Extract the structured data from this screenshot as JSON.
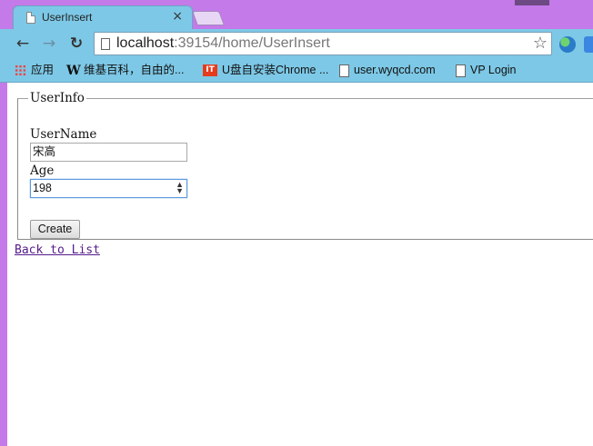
{
  "window": {
    "tab_title": "UserInsert",
    "tab_close": "×"
  },
  "toolbar": {
    "back_icon": "arrow-left-icon",
    "forward_icon": "arrow-right-icon",
    "reload_icon": "reload-icon",
    "url_host": "localhost",
    "url_rest": ":39154/home/UserInsert",
    "star_icon": "star-icon"
  },
  "bookmarks": [
    {
      "icon": "apps-icon",
      "label": "应用"
    },
    {
      "icon": "wikipedia-icon",
      "label": "维基百科，自由的..."
    },
    {
      "icon": "it-icon",
      "label": "U盘自安装Chrome ..."
    },
    {
      "icon": "doc-icon",
      "label": "user.wyqcd.com"
    },
    {
      "icon": "doc-icon",
      "label": "VP Login"
    }
  ],
  "form": {
    "legend": "UserInfo",
    "username_label": "UserName",
    "username_value": "宋高",
    "age_label": "Age",
    "age_value": "198",
    "create_button": "Create"
  },
  "back_link": "Back to List"
}
